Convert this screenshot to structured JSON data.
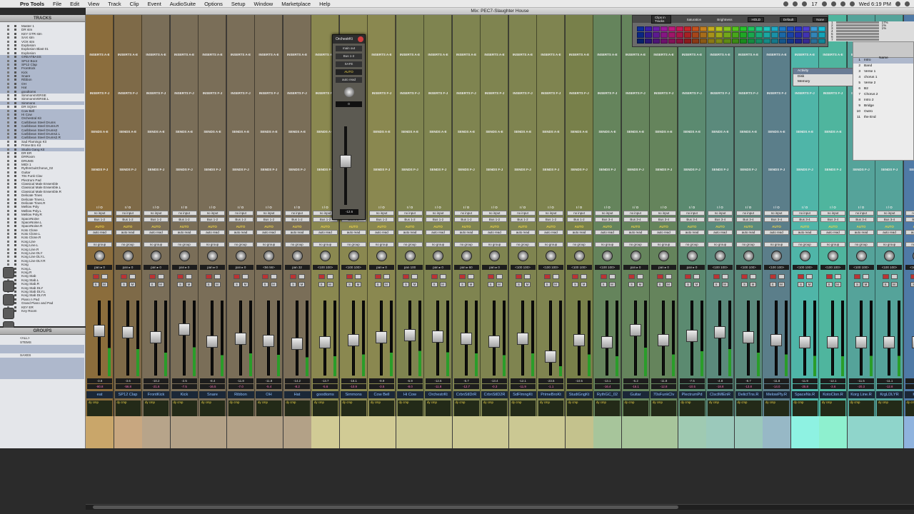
{
  "menubar": {
    "app": "Pro Tools",
    "items": [
      "File",
      "Edit",
      "View",
      "Track",
      "Clip",
      "Event",
      "AudioSuite",
      "Options",
      "Setup",
      "Window",
      "Marketplace",
      "Help"
    ],
    "clock": "Wed 6:19 PM",
    "number": "17"
  },
  "window": {
    "title": "Mix: PEC7-Slaughter House"
  },
  "tracks_panel": {
    "title": "TRACKS",
    "items": [
      {
        "name": "Master 1",
        "sel": false
      },
      {
        "name": "DR stm",
        "sel": false
      },
      {
        "name": "KEY GTR stm",
        "sel": false
      },
      {
        "name": "SAX stm",
        "sel": false
      },
      {
        "name": "VOX stm",
        "sel": false
      },
      {
        "name": "Explosion",
        "sel": false
      },
      {
        "name": "Explosion Blast 01",
        "sel": false
      },
      {
        "name": "Explosion",
        "sel": false
      },
      {
        "name": "GREATBASS",
        "sel": true
      },
      {
        "name": "SP12 Boot",
        "sel": true
      },
      {
        "name": "SP12 Clap",
        "sel": true
      },
      {
        "name": "FrontKick",
        "sel": true
      },
      {
        "name": "Kick",
        "sel": true
      },
      {
        "name": "Snare",
        "sel": true
      },
      {
        "name": "Ribbon",
        "sel": true
      },
      {
        "name": "OH",
        "sel": true
      },
      {
        "name": "Hat",
        "sel": true
      },
      {
        "name": "goodtoms",
        "sel": true
      },
      {
        "name": "SimmonsVERSE",
        "sel": false
      },
      {
        "name": "SimmonsVERSE.L",
        "sel": false
      },
      {
        "name": "Simmons",
        "sel": true
      },
      {
        "name": "DR SQSH",
        "sel": false
      },
      {
        "name": "Cow Bell",
        "sel": true
      },
      {
        "name": "Hi Cow",
        "sel": true
      },
      {
        "name": "Orchestral Kit",
        "sel": true
      },
      {
        "name": "Caribbean Steel Drums",
        "sel": true
      },
      {
        "name": "Caribbean Steel Drums.R",
        "sel": true
      },
      {
        "name": "Caribbean Steel Drums2",
        "sel": true
      },
      {
        "name": "Caribbean Steel Drums2.L",
        "sel": true
      },
      {
        "name": "Caribbean Steel Drums2.R",
        "sel": true
      },
      {
        "name": "Sad Flamingo Kit",
        "sel": false
      },
      {
        "name": "Prime Bro Kit",
        "sel": false
      },
      {
        "name": "Studio Gang Kit",
        "sel": true
      },
      {
        "name": "DR ER",
        "sel": false
      },
      {
        "name": "DRRoom",
        "sel": false
      },
      {
        "name": "DRUMS",
        "sel": false
      },
      {
        "name": "MIDI 1",
        "sel": false
      },
      {
        "name": "RythmGuitChorus_02",
        "sel": false
      },
      {
        "name": "Guitar",
        "sel": false
      },
      {
        "name": "70s Funk Clav",
        "sel": false
      },
      {
        "name": "Plectrum Pad",
        "sel": false
      },
      {
        "name": "Classical Male Ensemble",
        "sel": false
      },
      {
        "name": "Classical Male Ensemble.L",
        "sel": false
      },
      {
        "name": "Classical Male Ensemble.R",
        "sel": false
      },
      {
        "name": "Delicate Tines",
        "sel": false
      },
      {
        "name": "Delicate Tines.L",
        "sel": false
      },
      {
        "name": "Delicate Tines.R",
        "sel": false
      },
      {
        "name": "Mellow Poly",
        "sel": false
      },
      {
        "name": "Mellow Poly.L",
        "sel": false
      },
      {
        "name": "Mellow Poly.R",
        "sel": false
      },
      {
        "name": "SpaceNoise",
        "sel": false
      },
      {
        "name": "SpaceNoise.L",
        "sel": false
      },
      {
        "name": "SpaceNoise.R",
        "sel": false
      },
      {
        "name": "Koto Clone",
        "sel": false
      },
      {
        "name": "Koto Clone.L",
        "sel": false
      },
      {
        "name": "Koto Clone.R",
        "sel": false
      },
      {
        "name": "Korg Line",
        "sel": false
      },
      {
        "name": "Korg Line.L",
        "sel": false
      },
      {
        "name": "Korg Line.R",
        "sel": false
      },
      {
        "name": "Korg Line DLY",
        "sel": false
      },
      {
        "name": "Korg Line DLY.L",
        "sel": false
      },
      {
        "name": "Korg Line DLY.R",
        "sel": false
      },
      {
        "name": "Korg",
        "sel": false
      },
      {
        "name": "Korg.L",
        "sel": false
      },
      {
        "name": "Korg.R",
        "sel": false
      },
      {
        "name": "Korg Stab",
        "sel": false
      },
      {
        "name": "Korg Stab.L",
        "sel": false
      },
      {
        "name": "Korg Stab.R",
        "sel": false
      },
      {
        "name": "Korg Stab DLY",
        "sel": false
      },
      {
        "name": "Korg Stab DLY.L",
        "sel": false
      },
      {
        "name": "Korg Stab DLY.R",
        "sel": false
      },
      {
        "name": "Piano n Pad",
        "sel": false
      },
      {
        "name": "Grand Piano and Pad",
        "sel": false
      },
      {
        "name": "KEY ER",
        "sel": false
      },
      {
        "name": "Key Room",
        "sel": false
      }
    ]
  },
  "groups_panel": {
    "title": "GROUPS",
    "items": [
      {
        "name": "<ALL>",
        "sel": false
      },
      {
        "name": "STEMS",
        "sel": false
      },
      {
        "name": "",
        "sel": true
      },
      {
        "name": "",
        "sel": true
      },
      {
        "name": "SAXES",
        "sel": false
      },
      {
        "name": "",
        "sel": true
      },
      {
        "name": "",
        "sel": true
      },
      {
        "name": "",
        "sel": true
      },
      {
        "name": "",
        "sel": true
      },
      {
        "name": "",
        "sel": true
      }
    ]
  },
  "mixer": {
    "labels": {
      "inserts_ae": "INSERTS A-E",
      "inserts_fj": "INSERTS F-J",
      "sends_ae": "SENDS A-E",
      "sends_fj": "SENDS F-J",
      "io": "I / O",
      "no_input": "no input",
      "auto": "AUTO",
      "auto_read": "auto read",
      "no_group": "no group",
      "s": "S",
      "m": "M"
    },
    "strips": [
      {
        "name": "eat",
        "out": "Bus 1-2",
        "pan": "pan ▸ 0",
        "vol": "-3.8",
        "peak": "-80.8",
        "color": "#8b6d3c",
        "bottom": "#c9a66a",
        "fader": 0.62
      },
      {
        "name": "SP12 Clap",
        "out": "Bus 1-2",
        "pan": "pan ▸ 0",
        "vol": "-3.6",
        "peak": "-56.8",
        "color": "#7e6a48",
        "bottom": "#c8a780",
        "fader": 0.6
      },
      {
        "name": "FrontKick",
        "out": "Bus 1-2",
        "pan": "pan ▸ 0",
        "vol": "-10.2",
        "peak": "-21.6",
        "color": "#7a6e58",
        "bottom": "#b7a48a",
        "fader": 0.52
      },
      {
        "name": "Kick",
        "out": "Bus 1-2",
        "pan": "pan ▸ 0",
        "vol": "-2.5",
        "peak": "-7.5",
        "color": "#7a6e58",
        "bottom": "#b3a187",
        "fader": 0.64
      },
      {
        "name": "Snare",
        "out": "Bus 1-2",
        "pan": "pan ▸ 0",
        "vol": "-8.4",
        "peak": "-16.5",
        "color": "#7a6e58",
        "bottom": "#b3a187",
        "fader": 0.46
      },
      {
        "name": "Ribbon",
        "out": "Bus 1-2",
        "pan": "pan ▸ 0",
        "vol": "-11.8",
        "peak": "-7.0",
        "color": "#7a6e58",
        "bottom": "#b3a187",
        "fader": 0.5
      },
      {
        "name": "OH",
        "out": "Bus 1-2",
        "pan": "<56  56>",
        "vol": "-11.8",
        "peak": "-5.4",
        "color": "#7a6e58",
        "bottom": "#b3a187",
        "fader": 0.47
      },
      {
        "name": "Hat",
        "out": "Bus 1-2",
        "pan": "pan  32",
        "vol": "-14.2",
        "peak": "-8.2",
        "color": "#7a6e58",
        "bottom": "#b3a187",
        "fader": 0.42
      },
      {
        "name": "goodtoms",
        "out": "Bus 1-2",
        "pan": "<100 100>",
        "vol": "-13.7",
        "peak": "-5.6",
        "color": "#8a8850",
        "bottom": "#d1cb95",
        "fader": 0.44
      },
      {
        "name": "Simmons",
        "out": "Bus 1-2",
        "pan": "<100 100>",
        "vol": "-16.1",
        "peak": "-10.9",
        "color": "#8a8850",
        "bottom": "#d1cb95",
        "fader": 0.48
      },
      {
        "name": "Cow Bell",
        "out": "Bus 1-2",
        "pan": "pan ▸ 0",
        "vol": "-9.9",
        "peak": "-3.5",
        "color": "#8a8850",
        "bottom": "#d1cb95",
        "fader": 0.52
      },
      {
        "name": "Hi Cow",
        "out": "Bus 1-2",
        "pan": "pan  100",
        "vol": "-6.9",
        "peak": "-8.0",
        "color": "#7f8450",
        "bottom": "#cbc893",
        "fader": 0.56
      },
      {
        "name": "OrchestrKt",
        "out": "Bus 1-2",
        "pan": "pan ▸ 0",
        "vol": "-12.6",
        "peak": "-11.8",
        "color": "#7f8450",
        "bottom": "#cbc893",
        "fader": 0.53
      },
      {
        "name": "CrbnStlDrR",
        "out": "Bus 1-2",
        "pan": "pan ▸ 60",
        "vol": "-6.7",
        "peak": "-12.7",
        "color": "#7f8450",
        "bottom": "#cbc893",
        "fader": 0.5
      },
      {
        "name": "CrbnStlD2R",
        "out": "Bus 1-2",
        "pan": "pan ▸ 0",
        "vol": "-13.4",
        "peak": "-0.3",
        "color": "#7f8450",
        "bottom": "#cbc893",
        "fader": 0.46
      },
      {
        "name": "SdFlmngKt",
        "out": "Bus 1-2",
        "pan": "<100 100>",
        "vol": "-12.1",
        "peak": "-11.9",
        "color": "#7f8450",
        "bottom": "#cbc893",
        "fader": 0.5
      },
      {
        "name": "PrimeBroKt",
        "out": "Bus 1-2",
        "pan": "<100 100>",
        "vol": "-23.5",
        "peak": "-1.1",
        "color": "#7f8450",
        "bottom": "#cbc893",
        "fader": 0.22
      },
      {
        "name": "StudiGngKt",
        "out": "Bus 1-2",
        "pan": "<100 100>",
        "vol": "-10.5",
        "peak": "",
        "color": "#78804a",
        "bottom": "#c4c28d",
        "fader": 0.48
      },
      {
        "name": "RythGC_02",
        "out": "Bus 3-4",
        "pan": "<100 100>",
        "vol": "-13.1",
        "peak": "-16.4",
        "color": "#65845c",
        "bottom": "#a7c59b",
        "fader": 0.44
      },
      {
        "name": "Guitar",
        "out": "Bus 3-4",
        "pan": "pan ▸ 0",
        "vol": "-6.2",
        "peak": "-16.1",
        "color": "#65845c",
        "bottom": "#a7c59b",
        "fader": 0.63
      },
      {
        "name": "70sFunkClv",
        "out": "Bus 3-4",
        "pan": "pan ▸ 0",
        "vol": "-11.8",
        "peak": "-12.8",
        "color": "#65845c",
        "bottom": "#a7c59b",
        "fader": 0.48
      },
      {
        "name": "PlectrumPd",
        "out": "Bus 3-4",
        "pan": "pan ▸ 0",
        "vol": "-7.5",
        "peak": "-10.5",
        "color": "#5b8a70",
        "bottom": "#9fcab2",
        "fader": 0.55
      },
      {
        "name": "ClsclMlEnR",
        "out": "Bus 3-4",
        "pan": "<100 100>",
        "vol": "-4.8",
        "peak": "-18.8",
        "color": "#5b8a7c",
        "bottom": "#9bc9bb",
        "fader": 0.6
      },
      {
        "name": "DelictTns.R",
        "out": "Bus 3-4",
        "pan": "<100 100>",
        "vol": "-8.7",
        "peak": "-13.8",
        "color": "#5b8a7c",
        "bottom": "#9bc9bb",
        "fader": 0.52
      },
      {
        "name": "MelowPly.R",
        "out": "Bus 3-4",
        "pan": "<100 100>",
        "vol": "-11.8",
        "peak": "-14.0",
        "color": "#5b7e8a",
        "bottom": "#97b8c6",
        "fader": 0.48
      },
      {
        "name": "SpaceNs.R",
        "out": "Bus 3-4",
        "pan": "<100 100>",
        "vol": "-11.9",
        "peak": "-25.8",
        "color": "#4fb5a8",
        "bottom": "#8ef2e2",
        "fader": 0.45
      },
      {
        "name": "KotoClon.R",
        "out": "Bus 3-4",
        "pan": "<100 100>",
        "vol": "-12.1",
        "peak": "-3.6",
        "color": "#4fb59e",
        "bottom": "#8ef0cf",
        "fader": 0.44
      },
      {
        "name": "Korg Line.R",
        "out": "Bus 3-4",
        "pan": "<100 100>",
        "vol": "-11.5",
        "peak": "-20.3",
        "color": "#55a39a",
        "bottom": "#8fd5cb",
        "fader": 0.45
      },
      {
        "name": "KrgLDLYR",
        "out": "Bus 3-4",
        "pan": "<100 100>",
        "vol": "-11.1",
        "peak": "-12.8",
        "color": "#55a39a",
        "bottom": "#8fd5cb",
        "fader": 0.45
      },
      {
        "name": "Korg.",
        "out": "Bus 3-4",
        "pan": "<100 100>",
        "vol": "-11.5",
        "peak": "",
        "color": "#4f7aa6",
        "bottom": "#8fb3de",
        "fader": 0.45
      }
    ],
    "insert_tags": {
      "s2": "LAAD",
      "s6": "MetaFiltr",
      "s17": "MetaFltr",
      "s18": "MetaFilter",
      "s19": "AIR Talkbox",
      "s5": "Bus 15",
      "s17b": "Bus 11"
    }
  },
  "floater": {
    "name": "OrchestrKt",
    "out": "main out",
    "bus": "Bus 1-2",
    "safe": "SAFE",
    "auto": "AUTO",
    "auto_read": "auto read",
    "pan": "0",
    "vol": "-12.6"
  },
  "palette": {
    "title": "Clips in Tracks",
    "saturation": "Saturation",
    "brightness": "Brightness",
    "hold": "HOLD",
    "default": "Default",
    "none": "None",
    "colors": [
      "#0d2d9b",
      "#3a1fa8",
      "#6c1ea9",
      "#9c1a9a",
      "#bb1a7c",
      "#c41b55",
      "#c5262a",
      "#c5511e",
      "#c57f1e",
      "#c5ac1e",
      "#b7c51e",
      "#86c51e",
      "#54c51e",
      "#25c52b",
      "#1ec55c",
      "#1ec58e",
      "#1ec5bf",
      "#1eaac5",
      "#1e7ac5",
      "#1e4fc5",
      "#2b36c5",
      "#4d3cd0",
      "#3b9dd8",
      "#18c0d9"
    ]
  },
  "activity": {
    "title": "Activity",
    "disk": "Disk",
    "memory": "Memory"
  },
  "sysmon": {
    "rows": [
      "1",
      "2",
      "3",
      "4",
      "5",
      "6",
      "7"
    ],
    "vals": [
      "17%",
      "1%",
      "1%",
      "",
      "",
      "",
      ""
    ]
  },
  "markers": {
    "name_header": "Name",
    "rows": [
      {
        "n": "1",
        "t": "Intro",
        "sel": true
      },
      {
        "n": "2",
        "t": "Band",
        "sel": false
      },
      {
        "n": "3",
        "t": "Verse 1",
        "sel": false
      },
      {
        "n": "4",
        "t": "chorus 1",
        "sel": false
      },
      {
        "n": "5",
        "t": "Verse 2",
        "sel": false
      },
      {
        "n": "6",
        "t": "B2",
        "sel": false
      },
      {
        "n": "7",
        "t": "Chorus 2",
        "sel": false
      },
      {
        "n": "8",
        "t": "Intro 2",
        "sel": false
      },
      {
        "n": "9",
        "t": "Bridge",
        "sel": false
      },
      {
        "n": "10",
        "t": "Outro",
        "sel": false
      },
      {
        "n": "11",
        "t": "the End",
        "sel": false
      }
    ]
  }
}
